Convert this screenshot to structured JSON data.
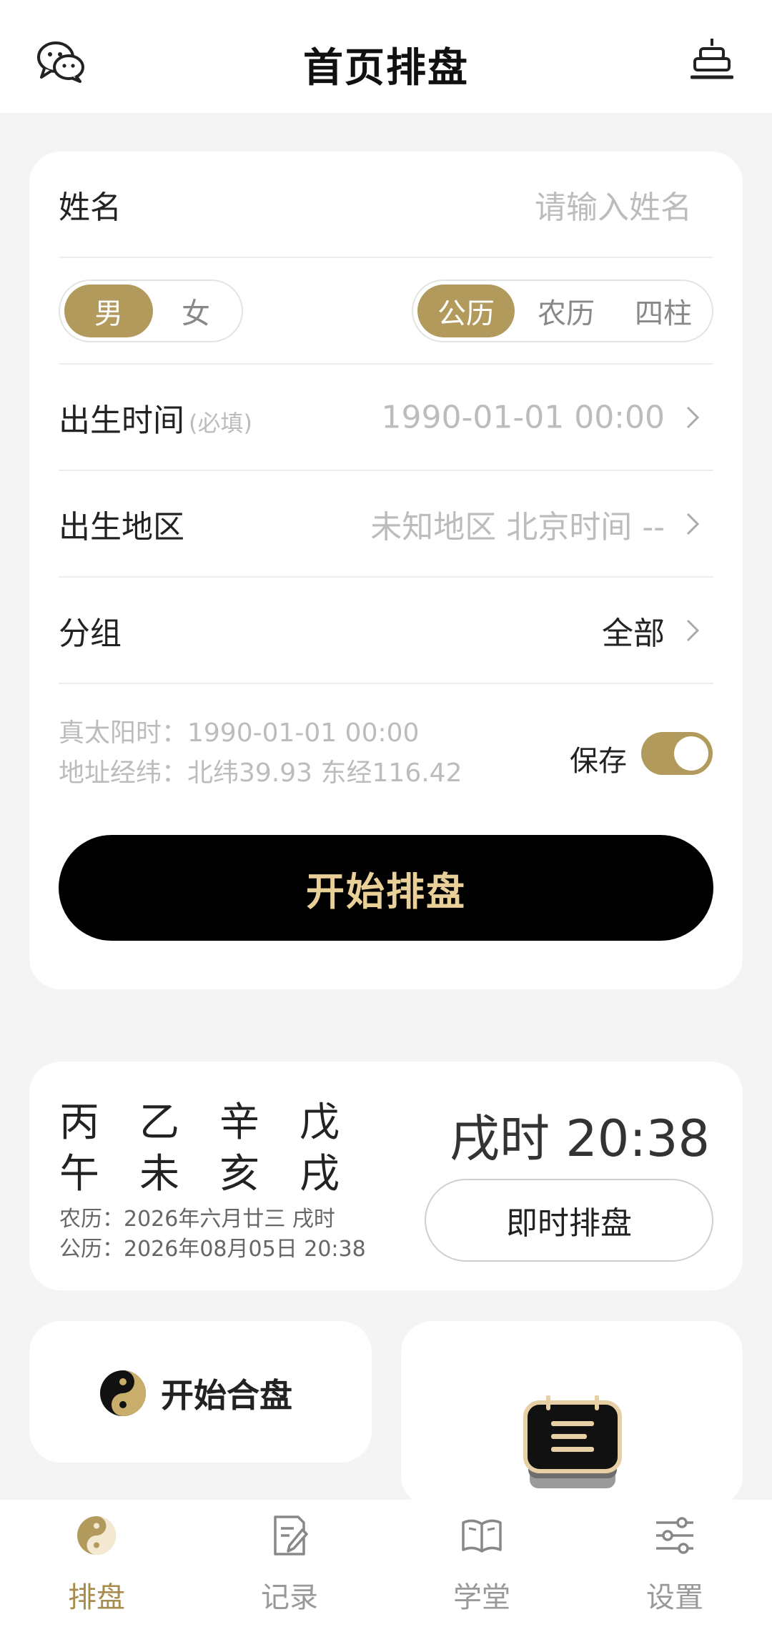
{
  "header": {
    "title": "首页排盘",
    "left_icon": "wechat-icon",
    "right_icon": "birthday-cake-icon"
  },
  "form": {
    "name_label": "姓名",
    "name_placeholder": "请输入姓名",
    "gender_options": [
      "男",
      "女"
    ],
    "gender_selected": "男",
    "calendar_options": [
      "公历",
      "农历",
      "四柱"
    ],
    "calendar_selected": "公历",
    "birth_time_label": "出生时间",
    "birth_time_hint": "(必填)",
    "birth_time_value": "1990-01-01 00:00",
    "birth_region_label": "出生地区",
    "birth_region_value": "未知地区 北京时间 --",
    "group_label": "分组",
    "group_value": "全部",
    "solar_time": "真太阳时：1990-01-01 00:00",
    "coordinates": "地址经纬：北纬39.93 东经116.42",
    "save_label": "保存",
    "save_on": true,
    "start_button": "开始排盘"
  },
  "now": {
    "bazi_row1": [
      "丙",
      "乙",
      "辛",
      "戊"
    ],
    "bazi_row2": [
      "午",
      "未",
      "亥",
      "戌"
    ],
    "lunar_date": "农历：2026年六月廿三 戌时",
    "solar_date": "公历：2026年08月05日 20:38",
    "clock": "戌时 20:38",
    "instant_button": "即时排盘"
  },
  "actions": {
    "hepan_label": "开始合盘"
  },
  "tabbar": {
    "items": [
      {
        "label": "排盘",
        "icon": "yin-yang-icon",
        "active": true
      },
      {
        "label": "记录",
        "icon": "edit-document-icon",
        "active": false
      },
      {
        "label": "学堂",
        "icon": "open-book-icon",
        "active": false
      },
      {
        "label": "设置",
        "icon": "sliders-icon",
        "active": false
      }
    ]
  },
  "colors": {
    "accent": "#b29a5c",
    "button_text": "#e9cf98",
    "placeholder": "#bcbcbc"
  }
}
